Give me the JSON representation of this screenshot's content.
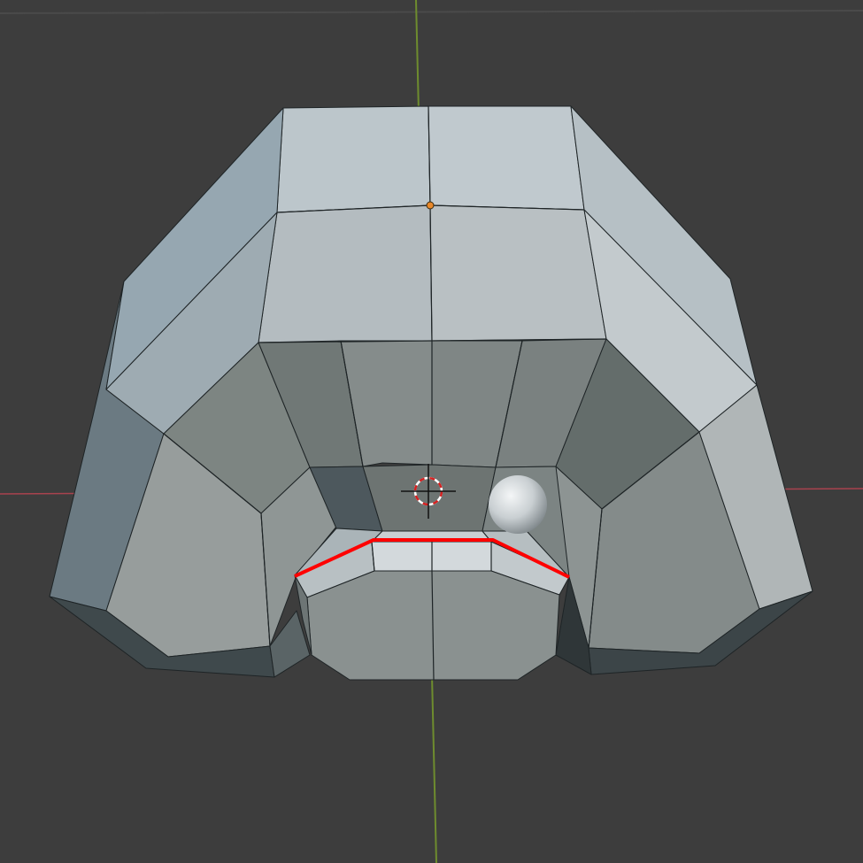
{
  "viewport": {
    "background": "#3d3d3d",
    "grid_line_color": "#4a4a4a",
    "x_axis_color": "#a8424e",
    "y_axis_color": "#6e8c2e",
    "edge_color": "#1e2426",
    "selection_color": "#ff0000",
    "origin_color": "#e8882a"
  },
  "scene": {
    "mesh": "low-poly-beak-shape",
    "cursor": "3d-cursor",
    "object": "small-sphere",
    "selected_edge_loop": "red-marked-edge-loop"
  }
}
